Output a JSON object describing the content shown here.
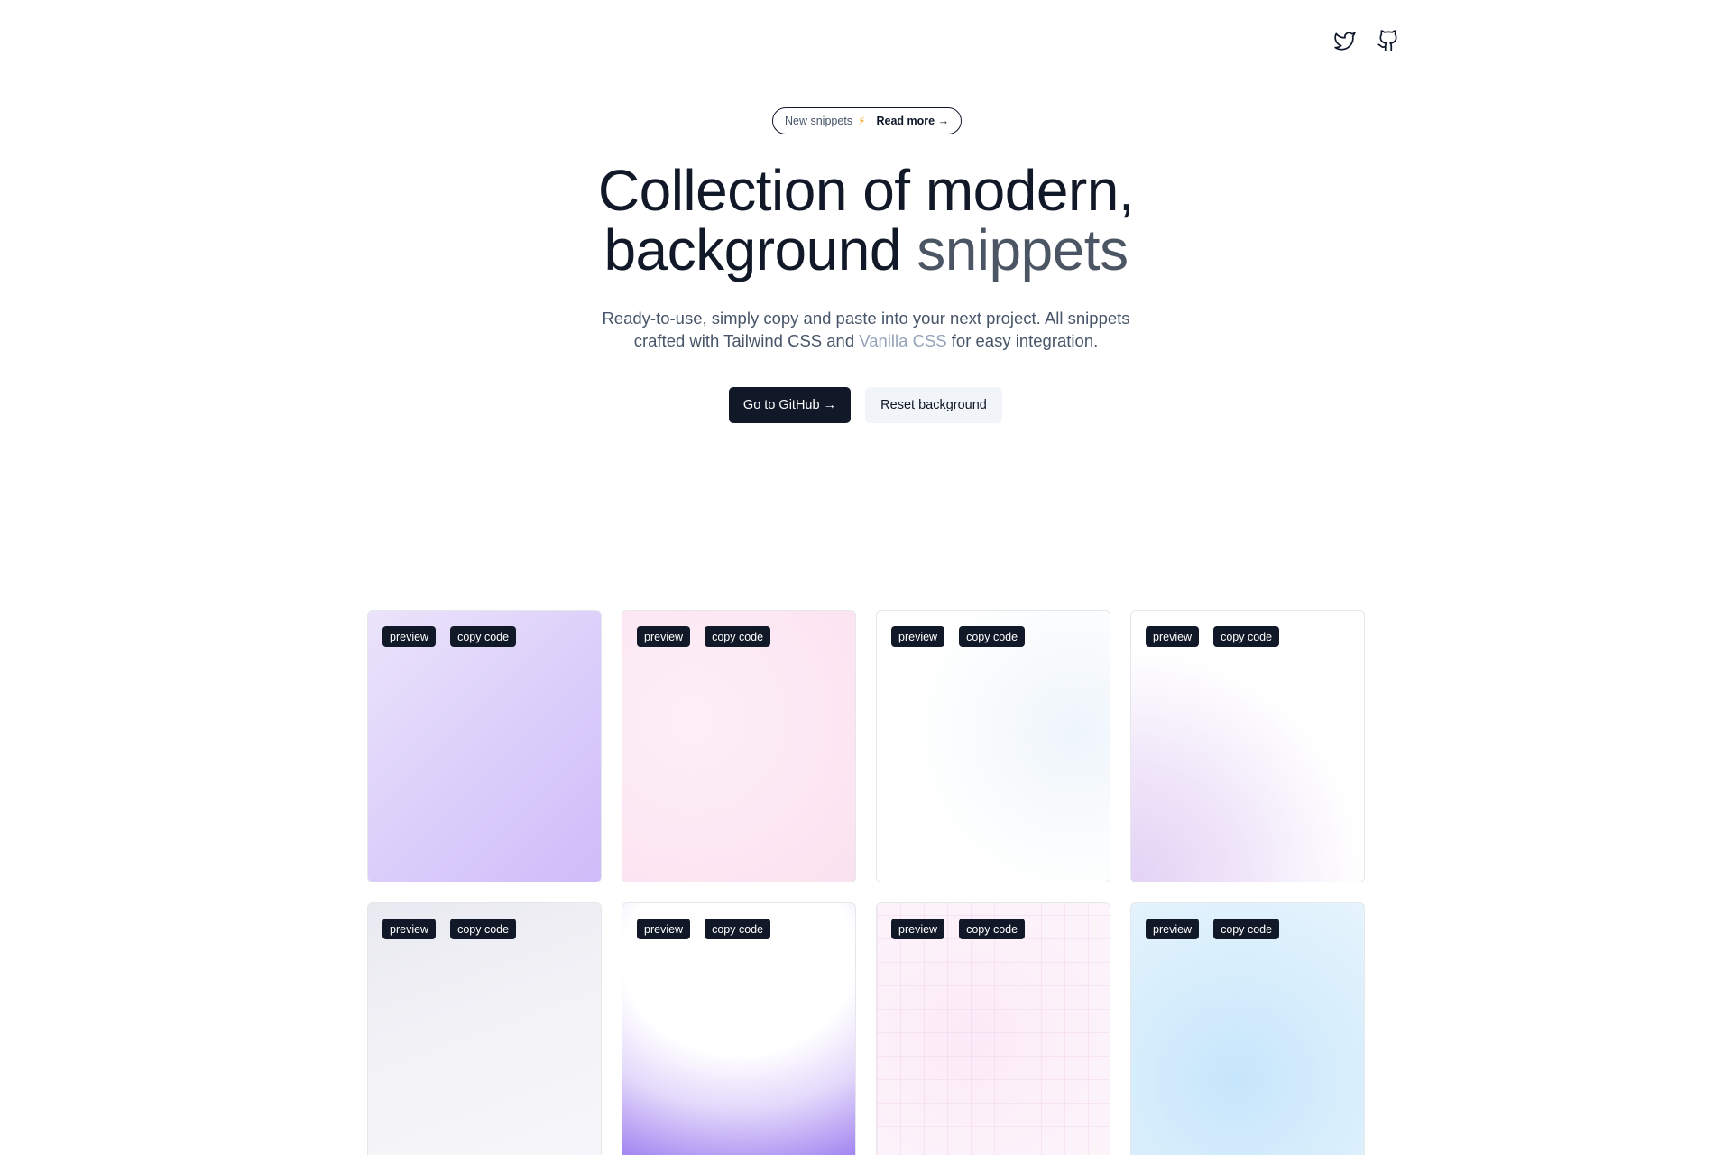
{
  "nav": {
    "icons": [
      "twitter-icon",
      "github-icon"
    ]
  },
  "announcement": {
    "label": "New snippets",
    "emoji": "⚡",
    "link": "Read more →"
  },
  "hero": {
    "title_line1": "Collection of modern,",
    "title_line2_a": "background",
    "title_line2_b": "snippets",
    "sub_line1": "Ready-to-use, simply copy and paste into your next project. All snippets",
    "sub_line2_a": "crafted with Tailwind CSS and",
    "sub_line2_link": "Vanilla CSS",
    "sub_line2_b": "for easy integration."
  },
  "buttons": {
    "github": "Go to GitHub →",
    "reset": "Reset background"
  },
  "cards": [
    {
      "preview": "preview",
      "copy": "copy code"
    },
    {
      "preview": "preview",
      "copy": "copy code"
    },
    {
      "preview": "preview",
      "copy": "copy code"
    },
    {
      "preview": "preview",
      "copy": "copy code"
    },
    {
      "preview": "preview",
      "copy": "copy code"
    },
    {
      "preview": "preview",
      "copy": "copy code"
    },
    {
      "preview": "preview",
      "copy": "copy code"
    },
    {
      "preview": "preview",
      "copy": "copy code"
    }
  ],
  "colors": {
    "text_primary": "#111827",
    "accent_gray": "#4b5563",
    "button_dark": "#111827",
    "button_light": "#f1f5f9"
  }
}
